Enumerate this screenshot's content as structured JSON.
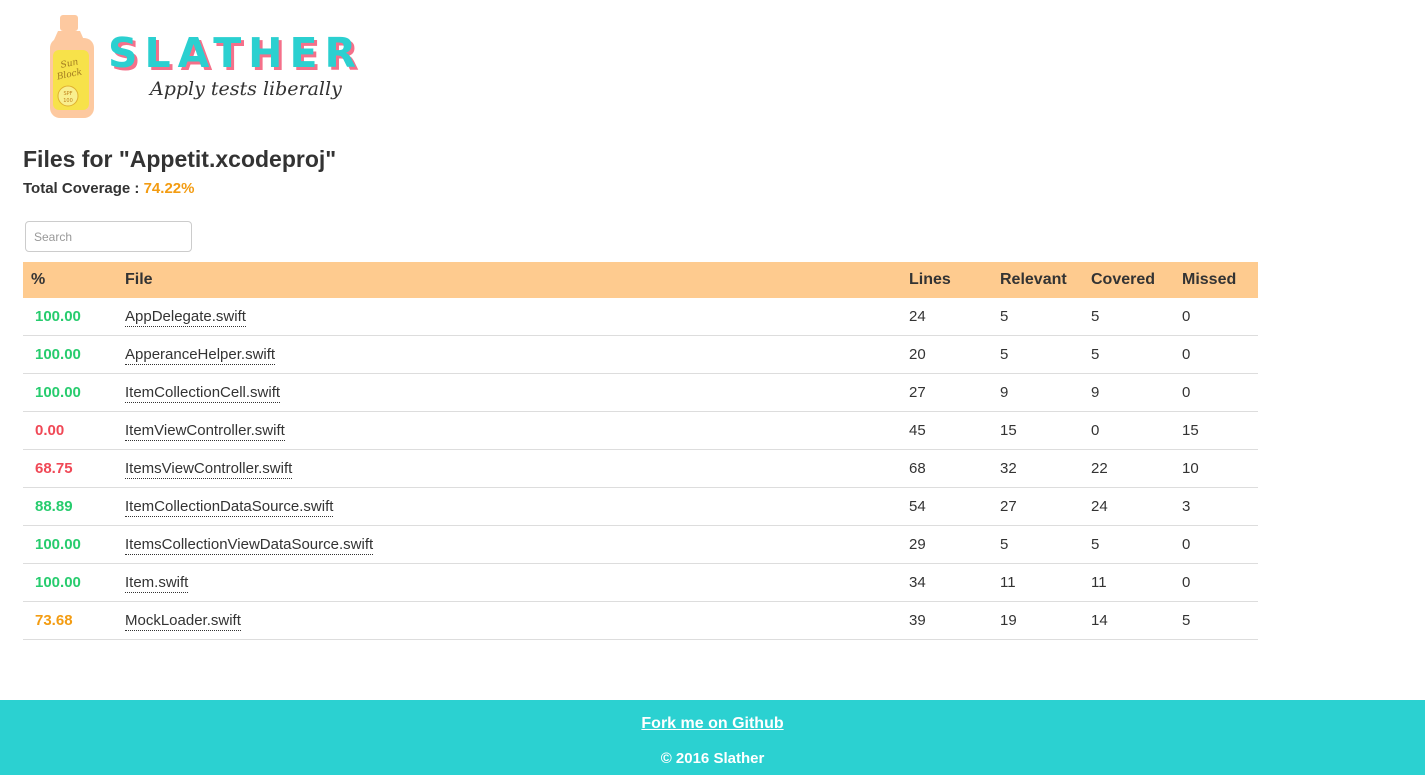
{
  "brand": {
    "name": "SLATHER",
    "tagline": "Apply tests liberally",
    "bottle_text_line1": "Sun",
    "bottle_text_line2": "Block",
    "bottle_spf": "SPF",
    "bottle_spf_value": "100",
    "colors": {
      "primary": "#2bd0d0",
      "shadow": "#f5708a",
      "bottle": "#fdc9a0",
      "label": "#f7e24a"
    }
  },
  "header": {
    "title": "Files for \"Appetit.xcodeproj\"",
    "total_label": "Total Coverage : ",
    "total_value": "74.22%"
  },
  "search": {
    "placeholder": "Search",
    "value": ""
  },
  "table": {
    "columns": [
      "%",
      "File",
      "Lines",
      "Relevant",
      "Covered",
      "Missed"
    ],
    "header_color": "#fecb8f",
    "rows": [
      {
        "pct": "100.00",
        "status": "good",
        "file": "AppDelegate.swift",
        "lines": "24",
        "relevant": "5",
        "covered": "5",
        "missed": "0"
      },
      {
        "pct": "100.00",
        "status": "good",
        "file": "ApperanceHelper.swift",
        "lines": "20",
        "relevant": "5",
        "covered": "5",
        "missed": "0"
      },
      {
        "pct": "100.00",
        "status": "good",
        "file": "ItemCollectionCell.swift",
        "lines": "27",
        "relevant": "9",
        "covered": "9",
        "missed": "0"
      },
      {
        "pct": "0.00",
        "status": "bad",
        "file": "ItemViewController.swift",
        "lines": "45",
        "relevant": "15",
        "covered": "0",
        "missed": "15"
      },
      {
        "pct": "68.75",
        "status": "bad",
        "file": "ItemsViewController.swift",
        "lines": "68",
        "relevant": "32",
        "covered": "22",
        "missed": "10"
      },
      {
        "pct": "88.89",
        "status": "good",
        "file": "ItemCollectionDataSource.swift",
        "lines": "54",
        "relevant": "27",
        "covered": "24",
        "missed": "3"
      },
      {
        "pct": "100.00",
        "status": "good",
        "file": "ItemsCollectionViewDataSource.swift",
        "lines": "29",
        "relevant": "5",
        "covered": "5",
        "missed": "0"
      },
      {
        "pct": "100.00",
        "status": "good",
        "file": "Item.swift",
        "lines": "34",
        "relevant": "11",
        "covered": "11",
        "missed": "0"
      },
      {
        "pct": "73.68",
        "status": "med",
        "file": "MockLoader.swift",
        "lines": "39",
        "relevant": "19",
        "covered": "14",
        "missed": "5"
      }
    ],
    "status_colors": {
      "good": "#27cc6e",
      "bad": "#f04856",
      "med": "#f39c12"
    }
  },
  "footer": {
    "link_label": "Fork me on Github",
    "copyright": "© 2016 Slather",
    "color": "#2bd1d1"
  }
}
